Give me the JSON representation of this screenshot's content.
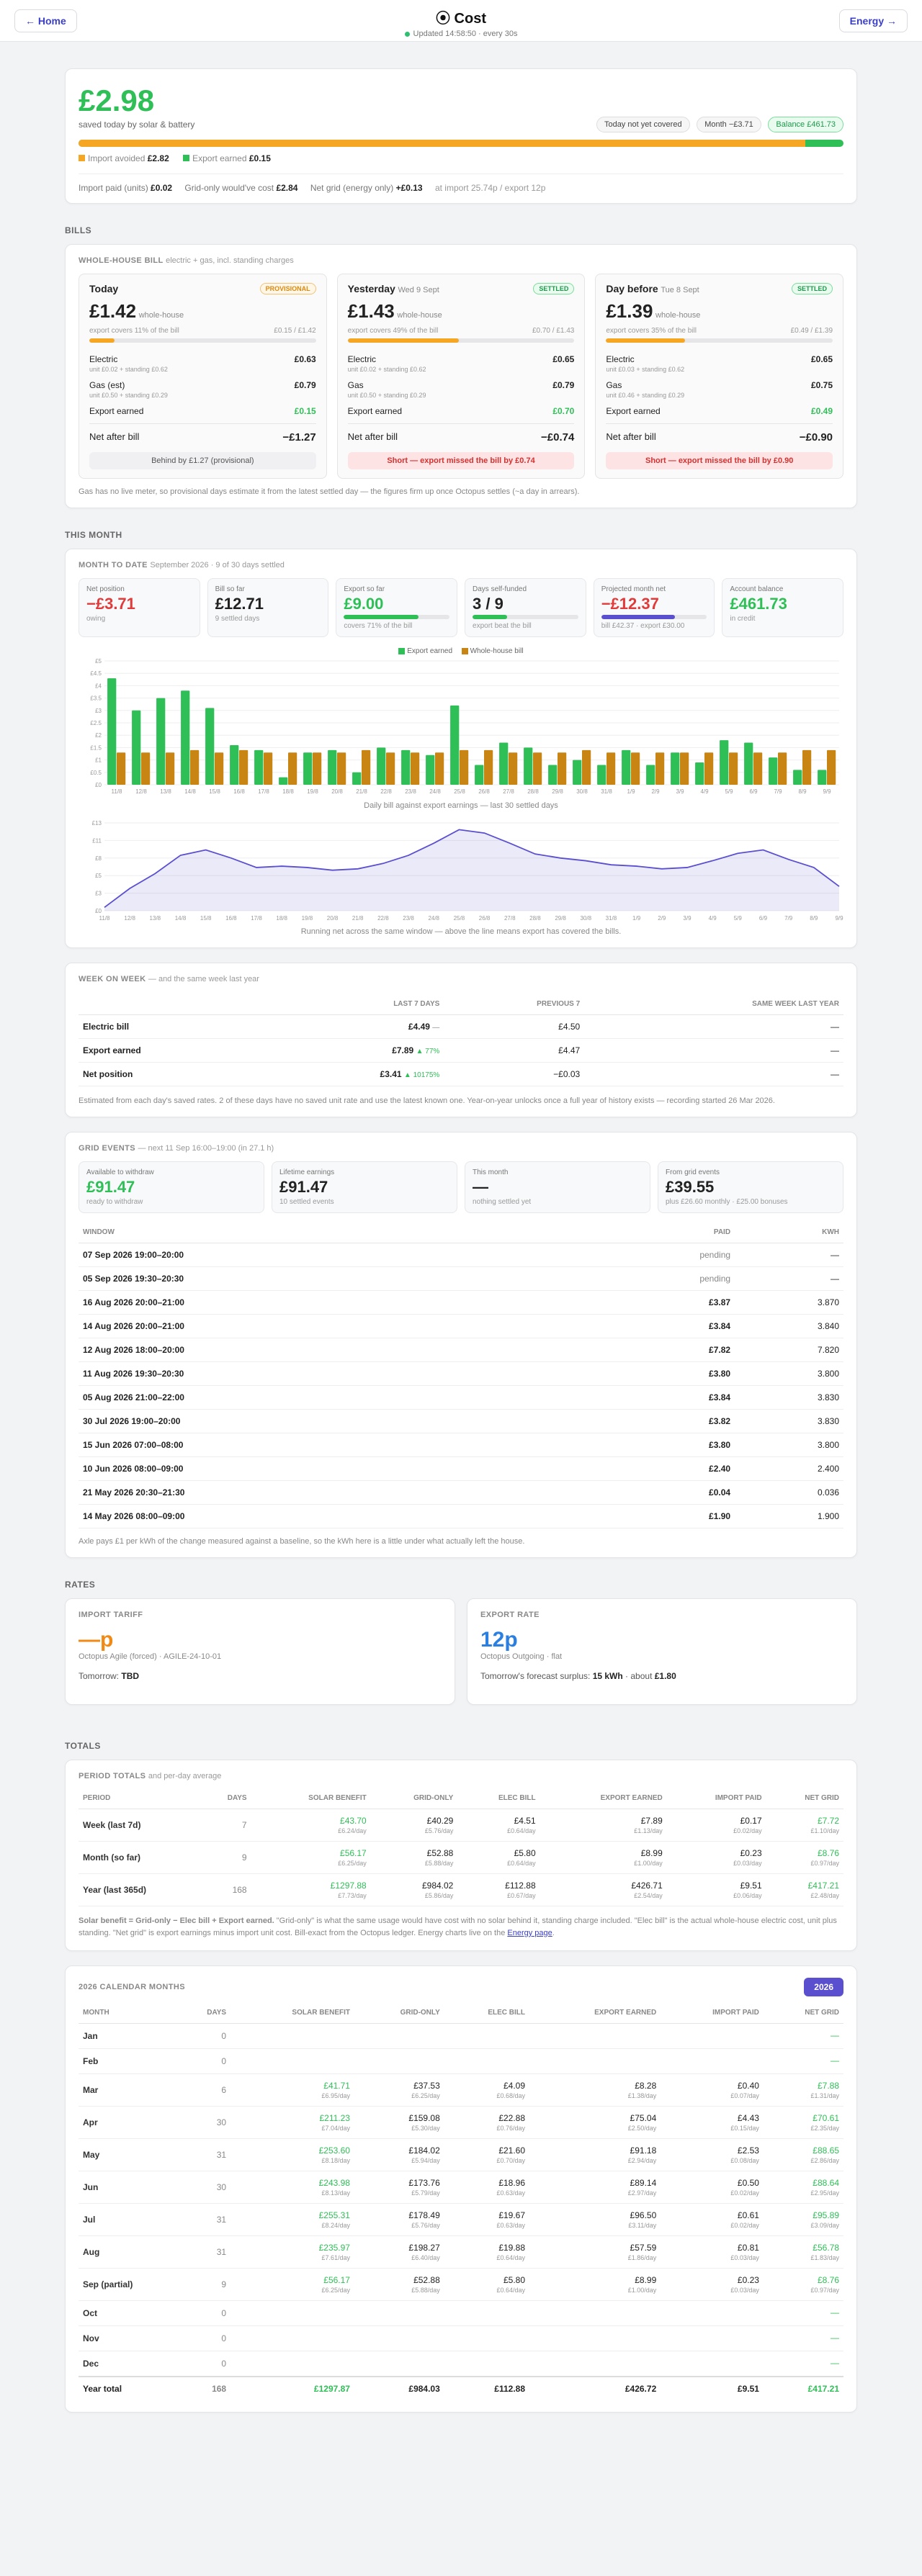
{
  "header": {
    "home": "← Home",
    "title": "Cost",
    "updated": "Updated 14:58:50 · every 30s",
    "energy": "Energy →"
  },
  "today": {
    "amount": "£2.98",
    "label": "saved today by solar & battery",
    "pill1": "Today not yet covered",
    "pill2": "Month −£3.71",
    "pill3": "Balance £461.73",
    "import_avoided_label": "Import avoided",
    "import_avoided": "£2.82",
    "export_label": "Export earned",
    "export": "£0.15",
    "import_paid_label": "Import paid (units)",
    "import_paid": "£0.02",
    "grid_only_label": "Grid-only would've cost",
    "grid_only": "£2.84",
    "net_grid_label": "Net grid (energy only)",
    "net_grid": "+£0.13",
    "at_import": "at import 25.74p / export 12p",
    "bar_split": 0.95
  },
  "bills": {
    "section": "Bills",
    "title": "Whole-house bill",
    "title_sub": "electric + gas, incl. standing charges",
    "footnote": "Gas has no live meter, so provisional days estimate it from the latest settled day — the figures firm up once Octopus settles (~a day in arrears).",
    "days": [
      {
        "name": "Today",
        "date": "",
        "badge": "PROVISIONAL",
        "amount": "£1.42",
        "unit": "whole-house",
        "cover": "export covers 11% of the bill",
        "ratio": "£0.15 / £1.42",
        "pct": 0.11,
        "elec": "£0.63",
        "elec_sub": "unit £0.02 + standing £0.62",
        "gas_label": "Gas (est)",
        "gas": "£0.79",
        "gas_sub": "unit £0.50 + standing £0.29",
        "export": "£0.15",
        "net": "−£1.27",
        "note": "Behind by £1.27 (provisional)"
      },
      {
        "name": "Yesterday",
        "date": "Wed 9 Sept",
        "badge": "SETTLED",
        "amount": "£1.43",
        "unit": "whole-house",
        "cover": "export covers 49% of the bill",
        "ratio": "£0.70 / £1.43",
        "pct": 0.49,
        "elec": "£0.65",
        "elec_sub": "unit £0.02 + standing £0.62",
        "gas_label": "Gas",
        "gas": "£0.79",
        "gas_sub": "unit £0.50 + standing £0.29",
        "export": "£0.70",
        "net": "−£0.74",
        "note": "Short — export missed the bill by £0.74"
      },
      {
        "name": "Day before",
        "date": "Tue 8 Sept",
        "badge": "SETTLED",
        "amount": "£1.39",
        "unit": "whole-house",
        "cover": "export covers 35% of the bill",
        "ratio": "£0.49 / £1.39",
        "pct": 0.35,
        "elec": "£0.65",
        "elec_sub": "unit £0.03 + standing £0.62",
        "gas_label": "Gas",
        "gas": "£0.75",
        "gas_sub": "unit £0.46 + standing £0.29",
        "export": "£0.49",
        "net": "−£0.90",
        "note": "Short — export missed the bill by £0.90"
      }
    ]
  },
  "month": {
    "section": "This month",
    "title": "Month to date",
    "title_sub": "September 2026 · 9 of 30 days settled",
    "stats": [
      {
        "l": "Net position",
        "v": "−£3.71",
        "s": "owing",
        "c": "red",
        "bar": null
      },
      {
        "l": "Bill so far",
        "v": "£12.71",
        "s": "9 settled days",
        "c": "",
        "bar": null
      },
      {
        "l": "Export so far",
        "v": "£9.00",
        "s": "covers 71% of the bill",
        "c": "green",
        "bar": 0.71,
        "barc": "#2fbf57"
      },
      {
        "l": "Days self-funded",
        "v": "3 / 9",
        "s": "export beat the bill",
        "c": "",
        "bar": 0.33,
        "barc": "#2fbf57"
      },
      {
        "l": "Projected month net",
        "v": "−£12.37",
        "s": "bill £42.37 · export £30.00",
        "c": "red",
        "bar": 0.7,
        "barc": "#5a4fcf"
      },
      {
        "l": "Account balance",
        "v": "£461.73",
        "s": "in credit",
        "c": "green",
        "bar": null
      }
    ],
    "legend_export": "Export earned",
    "legend_bill": "Whole-house bill",
    "chart1_caption": "Daily bill against export earnings — last 30 settled days",
    "chart2_caption": "Running net across the same window — above the line means export has covered the bills."
  },
  "chart_data": [
    {
      "type": "bar",
      "categories": [
        "11/8",
        "12/8",
        "13/8",
        "14/8",
        "15/8",
        "16/8",
        "17/8",
        "18/8",
        "19/8",
        "20/8",
        "21/8",
        "22/8",
        "23/8",
        "24/8",
        "25/8",
        "26/8",
        "27/8",
        "28/8",
        "29/8",
        "30/8",
        "31/8",
        "1/9",
        "2/9",
        "3/9",
        "4/9",
        "5/9",
        "6/9",
        "7/9",
        "8/9",
        "9/9"
      ],
      "series": [
        {
          "name": "Export earned",
          "values": [
            4.3,
            3.0,
            3.5,
            3.8,
            3.1,
            1.6,
            1.4,
            0.3,
            1.3,
            1.4,
            0.5,
            1.5,
            1.4,
            1.2,
            3.2,
            0.8,
            1.7,
            1.5,
            0.8,
            1.0,
            0.8,
            1.4,
            0.8,
            1.3,
            0.9,
            1.8,
            1.7,
            1.1,
            0.6,
            0.6
          ]
        },
        {
          "name": "Whole-house bill",
          "values": [
            1.3,
            1.3,
            1.3,
            1.4,
            1.3,
            1.4,
            1.3,
            1.3,
            1.3,
            1.3,
            1.4,
            1.3,
            1.3,
            1.3,
            1.4,
            1.4,
            1.3,
            1.3,
            1.3,
            1.4,
            1.3,
            1.3,
            1.3,
            1.3,
            1.3,
            1.3,
            1.3,
            1.3,
            1.4,
            1.4
          ]
        }
      ],
      "yticks": [
        "£0",
        "£0.5",
        "£1",
        "£1.5",
        "£2",
        "£2.5",
        "£3",
        "£3.5",
        "£4",
        "£4.5",
        "£5"
      ],
      "ylim": [
        0,
        5
      ]
    },
    {
      "type": "area",
      "x": [
        "11/8",
        "12/8",
        "13/8",
        "14/8",
        "15/8",
        "16/8",
        "17/8",
        "18/8",
        "19/8",
        "20/8",
        "21/8",
        "22/8",
        "23/8",
        "24/8",
        "25/8",
        "26/8",
        "27/8",
        "28/8",
        "29/8",
        "30/8",
        "31/8",
        "1/9",
        "2/9",
        "3/9",
        "4/9",
        "5/9",
        "6/9",
        "7/9",
        "8/9",
        "9/9"
      ],
      "y": [
        0.5,
        3.3,
        5.5,
        8.2,
        9.0,
        7.8,
        6.4,
        6.6,
        6.4,
        6.0,
        6.2,
        7.0,
        8.2,
        10.0,
        12.0,
        11.5,
        10.0,
        8.4,
        7.8,
        7.4,
        6.8,
        6.6,
        6.2,
        6.4,
        7.4,
        8.5,
        9.0,
        7.6,
        6.4,
        3.6
      ],
      "yticks": [
        "£0",
        "£3",
        "£5",
        "£8",
        "£11",
        "£13"
      ],
      "ylim": [
        0,
        13
      ]
    }
  ],
  "week": {
    "title": "Week on week",
    "title_sub": "— and the same week last year",
    "cols": [
      "",
      "Last 7 days",
      "Previous 7",
      "Same week last year"
    ],
    "rows": [
      {
        "n": "Electric bill",
        "v": "£4.49",
        "d": "—",
        "p": "£4.50",
        "y": "—"
      },
      {
        "n": "Export earned",
        "v": "£7.89",
        "d": "▲ 77%",
        "p": "£4.47",
        "y": "—"
      },
      {
        "n": "Net position",
        "v": "£3.41",
        "d": "▲ 10175%",
        "p": "−£0.03",
        "y": "—"
      }
    ],
    "note": "Estimated from each day's saved rates. 2 of these days have no saved unit rate and use the latest known one. Year-on-year unlocks once a full year of history exists — recording started 26 Mar 2026."
  },
  "grid": {
    "title": "Grid events",
    "title_sub": "— next 11 Sep 16:00–19:00 (in 27.1 h)",
    "stats": [
      {
        "l": "Available to withdraw",
        "v": "£91.47",
        "s": "ready to withdraw",
        "c": "green"
      },
      {
        "l": "Lifetime earnings",
        "v": "£91.47",
        "s": "10 settled events",
        "c": ""
      },
      {
        "l": "This month",
        "v": "—",
        "s": "nothing settled yet",
        "c": ""
      },
      {
        "l": "From grid events",
        "v": "£39.55",
        "s": "plus £26.60 monthly · £25.00 bonuses",
        "c": ""
      }
    ],
    "cols": [
      "Window",
      "Paid",
      "kWh"
    ],
    "rows": [
      [
        "07 Sep 2026 19:00–20:00",
        "pending",
        "—"
      ],
      [
        "05 Sep 2026 19:30–20:30",
        "pending",
        "—"
      ],
      [
        "16 Aug 2026 20:00–21:00",
        "£3.87",
        "3.870"
      ],
      [
        "14 Aug 2026 20:00–21:00",
        "£3.84",
        "3.840"
      ],
      [
        "12 Aug 2026 18:00–20:00",
        "£7.82",
        "7.820"
      ],
      [
        "11 Aug 2026 19:30–20:30",
        "£3.80",
        "3.800"
      ],
      [
        "05 Aug 2026 21:00–22:00",
        "£3.84",
        "3.830"
      ],
      [
        "30 Jul 2026 19:00–20:00",
        "£3.82",
        "3.830"
      ],
      [
        "15 Jun 2026 07:00–08:00",
        "£3.80",
        "3.800"
      ],
      [
        "10 Jun 2026 08:00–09:00",
        "£2.40",
        "2.400"
      ],
      [
        "21 May 2026 20:30–21:30",
        "£0.04",
        "0.036"
      ],
      [
        "14 May 2026 08:00–09:00",
        "£1.90",
        "1.900"
      ]
    ],
    "note": "Axle pays £1 per kWh of the change measured against a baseline, so the kWh here is a little under what actually left the house."
  },
  "rates": {
    "section": "Rates",
    "import_title": "Import tariff",
    "import_value": "—p",
    "import_sub": "Octopus Agile (forced) · AGILE-24-10-01",
    "tomorrow": "Tomorrow:",
    "tomorrow_v": "TBD",
    "export_title": "Export rate",
    "export_value": "12p",
    "export_sub": "Octopus Outgoing · flat",
    "forecast": "Tomorrow's forecast surplus:",
    "forecast_kwh": "15 kWh",
    "forecast_about": "· about",
    "forecast_gbp": "£1.80"
  },
  "totals": {
    "section": "Totals",
    "title": "Period totals",
    "title_sub": "and per-day average",
    "cols": [
      "Period",
      "Days",
      "Solar benefit",
      "Grid-only",
      "Elec bill",
      "Export earned",
      "Import paid",
      "Net grid"
    ],
    "rows": [
      [
        "Week (last 7d)",
        "7",
        "£43.70",
        "£6.24/day",
        "£40.29",
        "£5.76/day",
        "£4.51",
        "£0.64/day",
        "£7.89",
        "£1.13/day",
        "£0.17",
        "£0.02/day",
        "£7.72",
        "£1.10/day"
      ],
      [
        "Month (so far)",
        "9",
        "£56.17",
        "£6.25/day",
        "£52.88",
        "£5.88/day",
        "£5.80",
        "£0.64/day",
        "£8.99",
        "£1.00/day",
        "£0.23",
        "£0.03/day",
        "£8.76",
        "£0.97/day"
      ],
      [
        "Year (last 365d)",
        "168",
        "£1297.88",
        "£7.73/day",
        "£984.02",
        "£5.86/day",
        "£112.88",
        "£0.67/day",
        "£426.71",
        "£2.54/day",
        "£9.51",
        "£0.06/day",
        "£417.21",
        "£2.48/day"
      ]
    ],
    "note_pre": "Solar benefit = Grid-only − Elec bill + Export earned.",
    "note_body": "\"Grid-only\" is what the same usage would have cost with no solar behind it, standing charge included. \"Elec bill\" is the actual whole-house electric cost, unit plus standing. \"Net grid\" is export earnings minus import unit cost. Bill-exact from the Octopus ledger. Energy charts live on the",
    "note_link": "Energy page",
    "note_end": "."
  },
  "calendar": {
    "title": "2026 calendar months",
    "year_btn": "2026",
    "cols": [
      "Month",
      "Days",
      "Solar benefit",
      "Grid-only",
      "Elec bill",
      "Export earned",
      "Import paid",
      "Net grid"
    ],
    "rows": [
      [
        "Jan",
        "0",
        "",
        "",
        "",
        "",
        "",
        "",
        "",
        "",
        "",
        "",
        "—",
        ""
      ],
      [
        "Feb",
        "0",
        "",
        "",
        "",
        "",
        "",
        "",
        "",
        "",
        "",
        "",
        "—",
        ""
      ],
      [
        "Mar",
        "6",
        "£41.71",
        "£6.95/day",
        "£37.53",
        "£6.25/day",
        "£4.09",
        "£0.68/day",
        "£8.28",
        "£1.38/day",
        "£0.40",
        "£0.07/day",
        "£7.88",
        "£1.31/day"
      ],
      [
        "Apr",
        "30",
        "£211.23",
        "£7.04/day",
        "£159.08",
        "£5.30/day",
        "£22.88",
        "£0.76/day",
        "£75.04",
        "£2.50/day",
        "£4.43",
        "£0.15/day",
        "£70.61",
        "£2.35/day"
      ],
      [
        "May",
        "31",
        "£253.60",
        "£8.18/day",
        "£184.02",
        "£5.94/day",
        "£21.60",
        "£0.70/day",
        "£91.18",
        "£2.94/day",
        "£2.53",
        "£0.08/day",
        "£88.65",
        "£2.86/day"
      ],
      [
        "Jun",
        "30",
        "£243.98",
        "£8.13/day",
        "£173.76",
        "£5.79/day",
        "£18.96",
        "£0.63/day",
        "£89.14",
        "£2.97/day",
        "£0.50",
        "£0.02/day",
        "£88.64",
        "£2.95/day"
      ],
      [
        "Jul",
        "31",
        "£255.31",
        "£8.24/day",
        "£178.49",
        "£5.76/day",
        "£19.67",
        "£0.63/day",
        "£96.50",
        "£3.11/day",
        "£0.61",
        "£0.02/day",
        "£95.89",
        "£3.09/day"
      ],
      [
        "Aug",
        "31",
        "£235.97",
        "£7.61/day",
        "£198.27",
        "£6.40/day",
        "£19.88",
        "£0.64/day",
        "£57.59",
        "£1.86/day",
        "£0.81",
        "£0.03/day",
        "£56.78",
        "£1.83/day"
      ],
      [
        "Sep (partial)",
        "9",
        "£56.17",
        "£6.25/day",
        "£52.88",
        "£5.88/day",
        "£5.80",
        "£0.64/day",
        "£8.99",
        "£1.00/day",
        "£0.23",
        "£0.03/day",
        "£8.76",
        "£0.97/day"
      ],
      [
        "Oct",
        "0",
        "",
        "",
        "",
        "",
        "",
        "",
        "",
        "",
        "",
        "",
        "—",
        ""
      ],
      [
        "Nov",
        "0",
        "",
        "",
        "",
        "",
        "",
        "",
        "",
        "",
        "",
        "",
        "—",
        ""
      ],
      [
        "Dec",
        "0",
        "",
        "",
        "",
        "",
        "",
        "",
        "",
        "",
        "",
        "",
        "—",
        ""
      ]
    ],
    "total": [
      "Year total",
      "168",
      "£1297.87",
      "£984.03",
      "£112.88",
      "£426.72",
      "£9.51",
      "£417.21"
    ]
  }
}
